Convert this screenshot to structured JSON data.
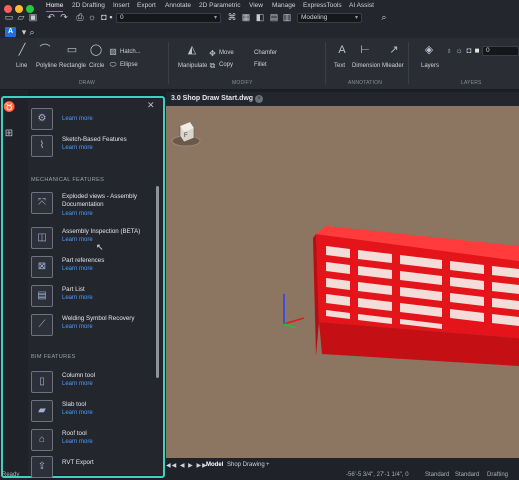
{
  "titlebar": {
    "layer_value": "0",
    "workspace_value": "Modeling"
  },
  "ribbon_tabs": [
    "Home",
    "2D Drafting",
    "Insert",
    "Export",
    "Annotate",
    "2D Parametric",
    "View",
    "Manage",
    "ExpressTools",
    "AI Assist"
  ],
  "ribbon": {
    "draw": {
      "line": "Line",
      "polyline": "Polyline",
      "rectangle": "Rectangle",
      "circle": "Circle",
      "hatch": "Hatch...",
      "ellipse": "Ellipse",
      "group_label": "DRAW"
    },
    "modify": {
      "manipulate": "Manipulate",
      "move": "Move",
      "copy": "Copy",
      "chamfer": "Chamfer",
      "fillet": "Fillet",
      "group_label": "MODIFY"
    },
    "annotation": {
      "text": "Text",
      "dimension": "Dimension",
      "mleader": "Mleader",
      "group_label": "ANNOTATION"
    },
    "layers": {
      "layers": "Layers",
      "layer_value": "0",
      "group_label": "LAYERS"
    }
  },
  "panel": {
    "items_top": [
      {
        "icon": "feature-icon",
        "name": "",
        "more": "Learn more"
      },
      {
        "icon": "sketch-icon",
        "name": "Sketch-Based Features",
        "more": "Learn more"
      }
    ],
    "mechanical_header": "MECHANICAL FEATURES",
    "mechanical_items": [
      {
        "icon": "exploded-view-icon",
        "name": "Exploded views - Assembly Documentation",
        "more": "Learn more"
      },
      {
        "icon": "assembly-inspection-icon",
        "name": "Assembly Inspection (BETA)",
        "more": "Learn more"
      },
      {
        "icon": "part-references-icon",
        "name": "Part references",
        "more": "Learn more"
      },
      {
        "icon": "part-list-icon",
        "name": "Part List",
        "more": "Learn more"
      },
      {
        "icon": "welding-icon",
        "name": "Welding Symbol Recovery",
        "more": "Learn more"
      }
    ],
    "bim_header": "BIM FEATURES",
    "bim_items": [
      {
        "icon": "column-tool-icon",
        "name": "Column tool",
        "more": "Learn more"
      },
      {
        "icon": "slab-tool-icon",
        "name": "Slab tool",
        "more": "Learn more"
      },
      {
        "icon": "roof-tool-icon",
        "name": "Roof tool",
        "more": "Learn more"
      },
      {
        "icon": "rvt-export-icon",
        "name": "RVT Export",
        "more": ""
      }
    ]
  },
  "document": {
    "tab_title": "3.0 Shop Draw Start.dwg"
  },
  "layout_tabs": {
    "model": "Model",
    "shop_drawing": "Shop Drawing",
    "add": "+"
  },
  "status": {
    "ready": "Ready",
    "coordinates": "-56'-5 3/4\", 27'-1 1/4\", 0",
    "standard1": "Standard",
    "standard2": "Standard",
    "drafting": "Drafting"
  },
  "colors": {
    "accent": "#3b8cff",
    "panel_outline": "#3fd1c0",
    "model_red": "#e5141a",
    "viewport_bg": "#8c7561"
  }
}
